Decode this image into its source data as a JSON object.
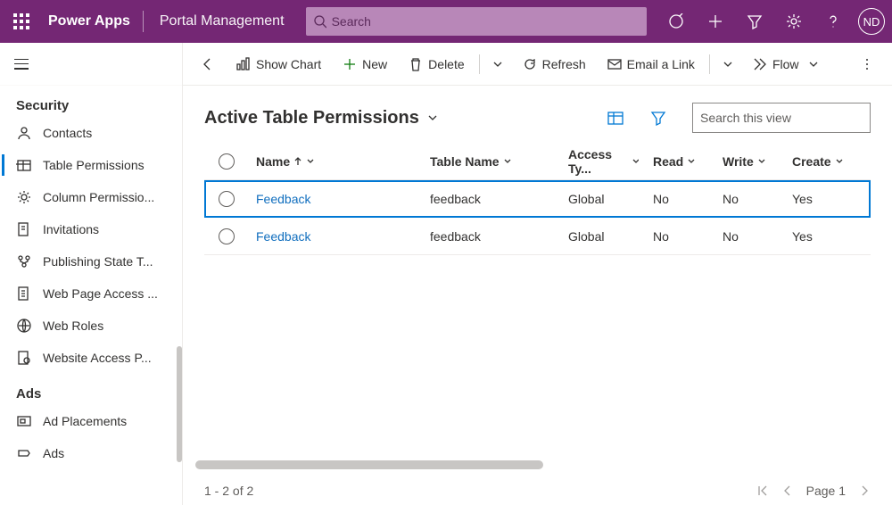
{
  "header": {
    "app_name": "Power Apps",
    "app_title": "Portal Management",
    "search_placeholder": "Search",
    "avatar_initials": "ND"
  },
  "commandbar": {
    "back_label": "Back",
    "show_chart": "Show Chart",
    "new": "New",
    "delete": "Delete",
    "refresh": "Refresh",
    "email_link": "Email a Link",
    "flow": "Flow"
  },
  "sidebar": {
    "group1_title": "Security",
    "items1": [
      {
        "label": "Contacts"
      },
      {
        "label": "Table Permissions"
      },
      {
        "label": "Column Permissio..."
      },
      {
        "label": "Invitations"
      },
      {
        "label": "Publishing State T..."
      },
      {
        "label": "Web Page Access ..."
      },
      {
        "label": "Web Roles"
      },
      {
        "label": "Website Access P..."
      }
    ],
    "group2_title": "Ads",
    "items2": [
      {
        "label": "Ad Placements"
      },
      {
        "label": "Ads"
      }
    ],
    "selected_index": 1
  },
  "view": {
    "title": "Active Table Permissions",
    "search_placeholder": "Search this view"
  },
  "columns": {
    "name": "Name",
    "table": "Table Name",
    "access": "Access Ty...",
    "read": "Read",
    "write": "Write",
    "create": "Create"
  },
  "rows": [
    {
      "name": "Feedback",
      "table": "feedback",
      "access": "Global",
      "read": "No",
      "write": "No",
      "create": "Yes",
      "selected": true
    },
    {
      "name": "Feedback",
      "table": "feedback",
      "access": "Global",
      "read": "No",
      "write": "No",
      "create": "Yes",
      "selected": false
    }
  ],
  "pager": {
    "status": "1 - 2 of 2",
    "page_label": "Page 1"
  }
}
